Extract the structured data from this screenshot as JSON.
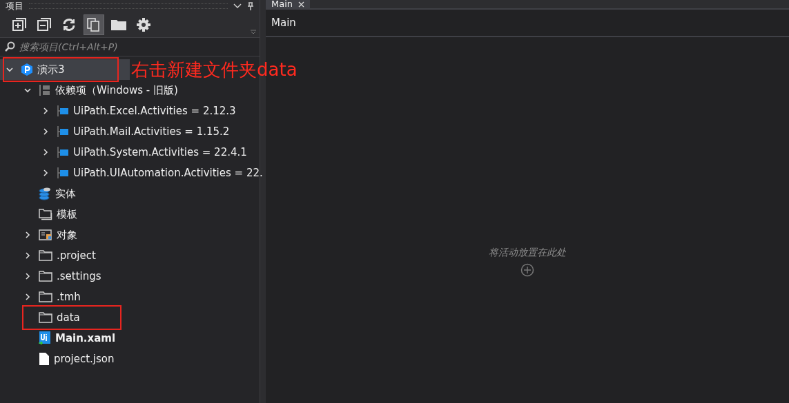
{
  "project_panel": {
    "title": "项目",
    "toolbar": [
      {
        "kind": "expand",
        "selected": false
      },
      {
        "kind": "collapse",
        "selected": false
      },
      {
        "kind": "refresh",
        "selected": false
      },
      {
        "kind": "copy",
        "selected": true
      },
      {
        "kind": "folder",
        "selected": false
      },
      {
        "kind": "settings",
        "selected": false
      }
    ],
    "search": {
      "placeholder": "搜索项目(Ctrl+Alt+P)"
    },
    "tree": [
      {
        "label": "演示3",
        "kind": "project",
        "expanded": true,
        "selected": true,
        "annotated": true,
        "children": [
          {
            "label": "依赖项（Windows - 旧版)",
            "kind": "dependencies",
            "expanded": true,
            "selected": false,
            "annotated": false,
            "children": [
              {
                "label": "UiPath.Excel.Activities = 2.12.3",
                "kind": "package",
                "expanded": false,
                "selected": false,
                "annotated": false
              },
              {
                "label": "UiPath.Mail.Activities = 1.15.2",
                "kind": "package",
                "expanded": false,
                "selected": false,
                "annotated": false
              },
              {
                "label": "UiPath.System.Activities = 22.4.1",
                "kind": "package",
                "expanded": false,
                "selected": false,
                "annotated": false
              },
              {
                "label": "UiPath.UIAutomation.Activities = 22.",
                "kind": "package",
                "expanded": false,
                "selected": false,
                "annotated": false
              }
            ]
          },
          {
            "label": "实体",
            "kind": "entities",
            "selected": false,
            "annotated": false
          },
          {
            "label": "模板",
            "kind": "templates",
            "selected": false,
            "annotated": false
          },
          {
            "label": "对象",
            "kind": "objects",
            "expanded": false,
            "selected": false,
            "annotated": false
          },
          {
            "label": ".project",
            "kind": "folder",
            "expanded": false,
            "selected": false,
            "annotated": false
          },
          {
            "label": ".settings",
            "kind": "folder",
            "expanded": false,
            "selected": false,
            "annotated": false
          },
          {
            "label": ".tmh",
            "kind": "folder",
            "expanded": false,
            "selected": false,
            "annotated": false
          },
          {
            "label": "data",
            "kind": "folder",
            "selected": false,
            "annotated": true
          },
          {
            "label": "Main.xaml",
            "kind": "workflow",
            "selected": false,
            "annotated": false
          },
          {
            "label": "project.json",
            "kind": "file",
            "selected": false,
            "annotated": false
          }
        ]
      }
    ]
  },
  "annotation_note": "右击新建文件夹data",
  "editor": {
    "tabs": [
      {
        "label": "Main",
        "selected": true
      }
    ],
    "breadcrumb": "Main",
    "hint": "将活动放置在此处"
  }
}
